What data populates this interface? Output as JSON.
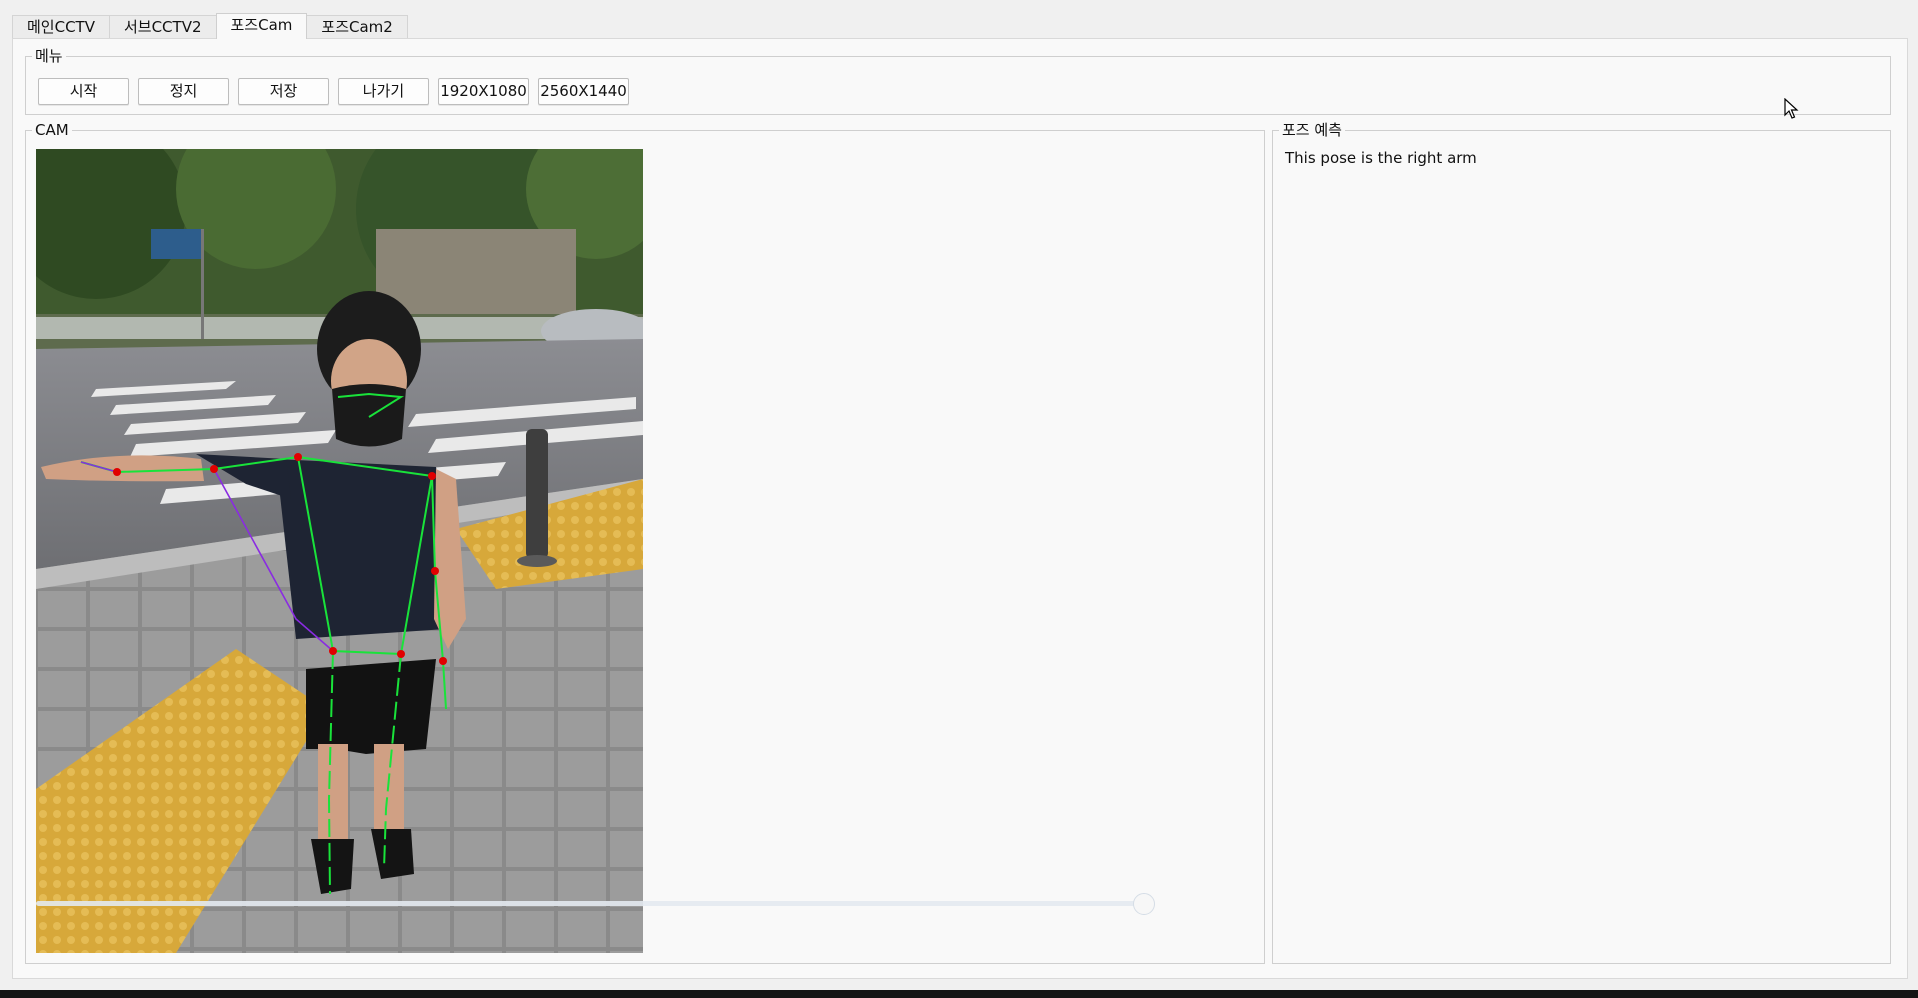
{
  "tabs": [
    {
      "label": "메인CCTV"
    },
    {
      "label": "서브CCTV2"
    },
    {
      "label": "포즈Cam"
    },
    {
      "label": "포즈Cam2"
    }
  ],
  "active_tab": "포즈Cam",
  "menu": {
    "title": "메뉴",
    "buttons": [
      {
        "label": "시작"
      },
      {
        "label": "정지"
      },
      {
        "label": "저장"
      },
      {
        "label": "나가기"
      },
      {
        "label": "1920X1080"
      },
      {
        "label": "2560X1440"
      }
    ]
  },
  "cam": {
    "title": "CAM",
    "image_description": "camera frame: child in street with pose skeleton overlay"
  },
  "pose": {
    "title": "포즈 예측",
    "result": "This pose is the right arm"
  },
  "icons": {
    "cursor": "mouse-pointer-icon"
  }
}
